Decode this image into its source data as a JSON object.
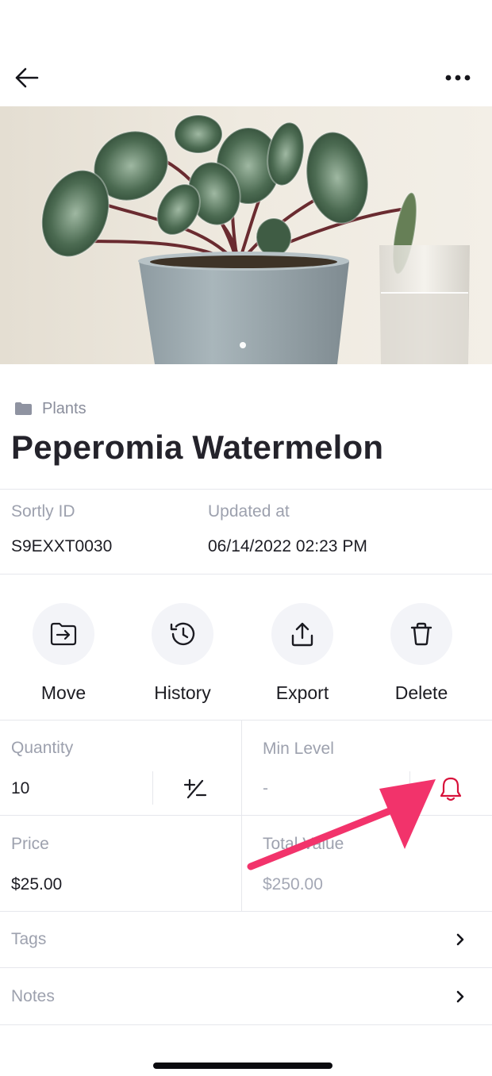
{
  "header": {
    "back_icon": "arrow-left-icon",
    "more_icon": "more-horizontal-icon"
  },
  "hero": {
    "image_subject": "potted peperomia plant",
    "pager_count": 1,
    "pager_active": 1
  },
  "item": {
    "folder": "Plants",
    "folder_icon": "folder-icon",
    "name": "Peperomia Watermelon"
  },
  "meta": {
    "sortly_id_label": "Sortly ID",
    "sortly_id_value": "S9EXXT0030",
    "updated_label": "Updated at",
    "updated_value": "06/14/2022 02:23 PM"
  },
  "actions": [
    {
      "label": "Move",
      "icon": "move-folder-icon"
    },
    {
      "label": "History",
      "icon": "history-icon"
    },
    {
      "label": "Export",
      "icon": "export-icon"
    },
    {
      "label": "Delete",
      "icon": "trash-icon"
    }
  ],
  "fields": {
    "quantity_label": "Quantity",
    "quantity_value": "10",
    "min_level_label": "Min Level",
    "min_level_value": "-",
    "price_label": "Price",
    "price_value": "$25.00",
    "total_value_label": "Total Value",
    "total_value_value": "$250.00"
  },
  "links": {
    "tags_label": "Tags",
    "notes_label": "Notes"
  },
  "colors": {
    "accent_alert": "#d8123b",
    "annotation_arrow": "#f2336b",
    "muted_text": "#9da1ae"
  }
}
